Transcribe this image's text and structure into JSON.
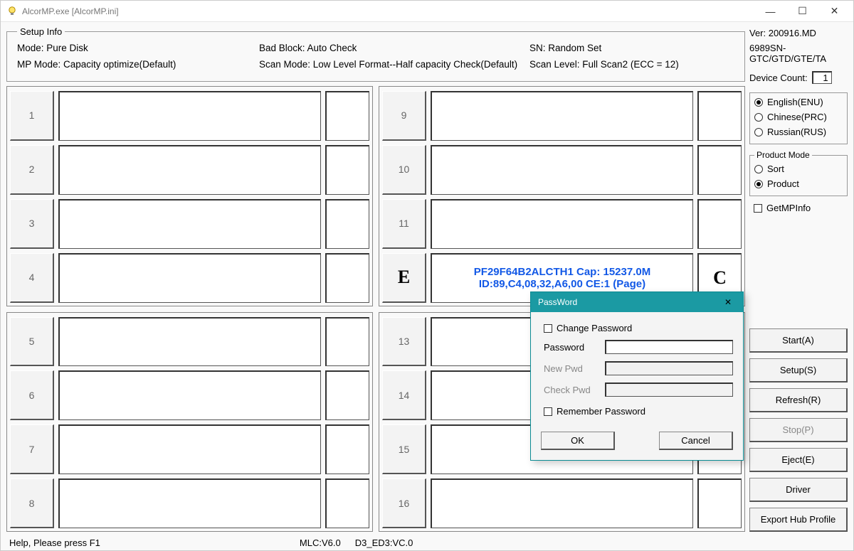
{
  "title": "AlcorMP.exe [AlcorMP.ini]",
  "setup": {
    "legend": "Setup Info",
    "mode": "Mode: Pure Disk",
    "bad_block": "Bad Block: Auto Check",
    "sn": "SN: Random Set",
    "mp_mode": "MP Mode: Capacity optimize(Default)",
    "scan_mode": "Scan Mode: Low Level Format--Half capacity Check(Default)",
    "scan_level": "Scan Level: Full Scan2 (ECC = 12)"
  },
  "slots": {
    "left_top": [
      "1",
      "2",
      "3",
      "4"
    ],
    "right_top_nums": [
      "9",
      "10",
      "11"
    ],
    "e_label": "E",
    "e_line1": "PF29F64B2ALCTH1 Cap: 15237.0M",
    "e_line2": "ID:89,C4,08,32,A6,00 CE:1 (Page)",
    "e_ind": "C",
    "left_bot": [
      "5",
      "6",
      "7",
      "8"
    ],
    "right_bot": [
      "13",
      "14",
      "15",
      "16"
    ]
  },
  "side": {
    "ver": "Ver: 200916.MD",
    "chip": "6989SN-GTC/GTD/GTE/TA",
    "device_count_label": "Device Count:",
    "device_count": "1",
    "lang": {
      "en": "English(ENU)",
      "cn": "Chinese(PRC)",
      "ru": "Russian(RUS)"
    },
    "product_mode": {
      "legend": "Product Mode",
      "sort": "Sort",
      "product": "Product"
    },
    "getmp": "GetMPInfo",
    "buttons": {
      "start": "Start(A)",
      "setup": "Setup(S)",
      "refresh": "Refresh(R)",
      "stop": "Stop(P)",
      "eject": "Eject(E)",
      "driver": "Driver",
      "export": "Export Hub Profile"
    }
  },
  "status": {
    "help": "Help, Please press F1",
    "mlc": "MLC:V6.0",
    "d3": "D3_ED3:VC.0"
  },
  "dialog": {
    "title": "PassWord",
    "change": "Change Password",
    "password": "Password",
    "newpwd": "New Pwd",
    "checkpwd": "Check Pwd",
    "remember": "Remember Password",
    "ok": "OK",
    "cancel": "Cancel"
  }
}
